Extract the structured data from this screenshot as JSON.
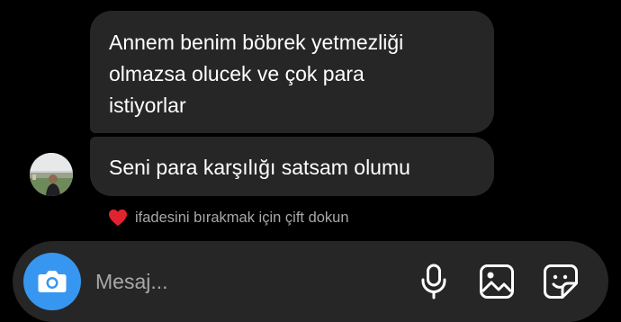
{
  "messages": [
    {
      "sender": "them",
      "lines": [
        "Annem benim böbrek yetmezliği",
        "olmazsa olucek ve çok para",
        "istiyorlar"
      ]
    },
    {
      "sender": "them",
      "lines": [
        "Seni para karşılığı satsam olumu"
      ]
    }
  ],
  "reaction_hint": {
    "icon": "heart-icon",
    "text": "ifadesini bırakmak için çift dokun"
  },
  "composer": {
    "placeholder": "Mesaj...",
    "icons": [
      "camera-icon",
      "microphone-icon",
      "gallery-icon",
      "sticker-icon"
    ]
  },
  "colors": {
    "background": "#000000",
    "bubble": "#262626",
    "camera_button": "#3797f0",
    "heart": "#e0242f",
    "hint_text": "#a8a8a8"
  }
}
